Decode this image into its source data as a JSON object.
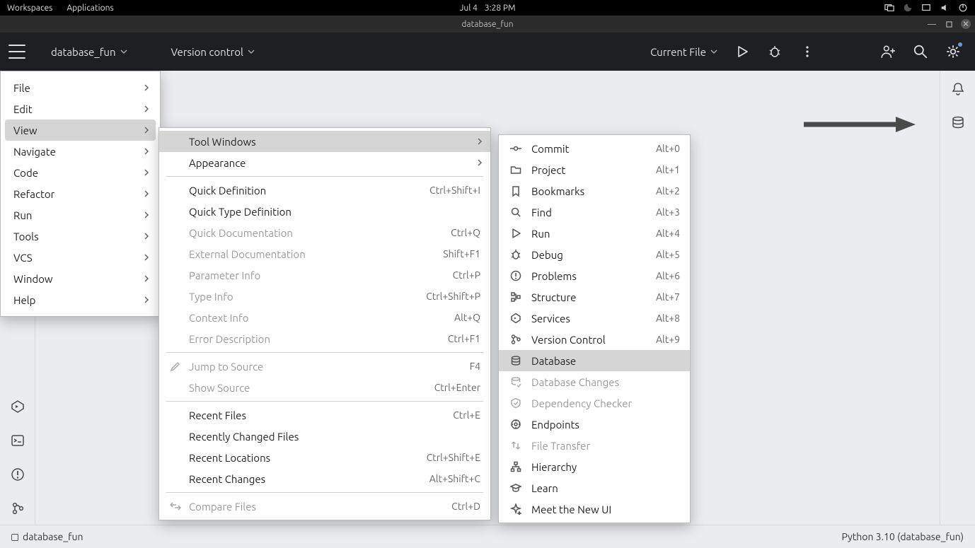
{
  "system_bar": {
    "workspaces": "Workspaces",
    "applications": "Applications",
    "date": "Jul 4",
    "time": "3:28 PM"
  },
  "window_title": "database_fun",
  "toolbar": {
    "project": "database_fun",
    "vcs": "Version control",
    "run_config": "Current File"
  },
  "main_menu": [
    {
      "label": "File"
    },
    {
      "label": "Edit"
    },
    {
      "label": "View",
      "highlighted": true
    },
    {
      "label": "Navigate"
    },
    {
      "label": "Code"
    },
    {
      "label": "Refactor"
    },
    {
      "label": "Run"
    },
    {
      "label": "Tools"
    },
    {
      "label": "VCS"
    },
    {
      "label": "Window"
    },
    {
      "label": "Help"
    }
  ],
  "view_menu": [
    {
      "label": "Tool Windows",
      "submenu": true,
      "highlighted": true
    },
    {
      "label": "Appearance",
      "submenu": true
    },
    {
      "sep": true
    },
    {
      "label": "Quick Definition",
      "shortcut": "Ctrl+Shift+I"
    },
    {
      "label": "Quick Type Definition"
    },
    {
      "label": "Quick Documentation",
      "shortcut": "Ctrl+Q",
      "disabled": true
    },
    {
      "label": "External Documentation",
      "shortcut": "Shift+F1",
      "disabled": true
    },
    {
      "label": "Parameter Info",
      "shortcut": "Ctrl+P",
      "disabled": true
    },
    {
      "label": "Type Info",
      "shortcut": "Ctrl+Shift+P",
      "disabled": true
    },
    {
      "label": "Context Info",
      "shortcut": "Alt+Q",
      "disabled": true
    },
    {
      "label": "Error Description",
      "shortcut": "Ctrl+F1",
      "disabled": true
    },
    {
      "sep": true
    },
    {
      "label": "Jump to Source",
      "shortcut": "F4",
      "icon": "pencil",
      "disabled": true
    },
    {
      "label": "Show Source",
      "shortcut": "Ctrl+Enter",
      "disabled": true
    },
    {
      "sep": true
    },
    {
      "label": "Recent Files",
      "shortcut": "Ctrl+E"
    },
    {
      "label": "Recently Changed Files"
    },
    {
      "label": "Recent Locations",
      "shortcut": "Ctrl+Shift+E"
    },
    {
      "label": "Recent Changes",
      "shortcut": "Alt+Shift+C"
    },
    {
      "sep": true
    },
    {
      "label": "Compare Files",
      "shortcut": "Ctrl+D",
      "icon": "compare",
      "disabled": true
    }
  ],
  "toolwin_menu": [
    {
      "label": "Commit",
      "shortcut": "Alt+0",
      "icon": "commit"
    },
    {
      "label": "Project",
      "shortcut": "Alt+1",
      "icon": "folder"
    },
    {
      "label": "Bookmarks",
      "shortcut": "Alt+2",
      "icon": "bookmark"
    },
    {
      "label": "Find",
      "shortcut": "Alt+3",
      "icon": "search"
    },
    {
      "label": "Run",
      "shortcut": "Alt+4",
      "icon": "play"
    },
    {
      "label": "Debug",
      "shortcut": "Alt+5",
      "icon": "bug"
    },
    {
      "label": "Problems",
      "shortcut": "Alt+6",
      "icon": "warn"
    },
    {
      "label": "Structure",
      "shortcut": "Alt+7",
      "icon": "structure"
    },
    {
      "label": "Services",
      "shortcut": "Alt+8",
      "icon": "services"
    },
    {
      "label": "Version Control",
      "shortcut": "Alt+9",
      "icon": "branch"
    },
    {
      "label": "Database",
      "icon": "database",
      "highlighted": true
    },
    {
      "label": "Database Changes",
      "icon": "dbchanges",
      "disabled": true
    },
    {
      "label": "Dependency Checker",
      "icon": "depcheck",
      "disabled": true
    },
    {
      "label": "Endpoints",
      "icon": "endpoints"
    },
    {
      "label": "File Transfer",
      "icon": "transfer",
      "disabled": true
    },
    {
      "label": "Hierarchy",
      "icon": "hierarchy"
    },
    {
      "label": "Learn",
      "icon": "learn"
    },
    {
      "label": "Meet the New UI",
      "icon": "sparkle"
    }
  ],
  "status_bar": {
    "left": "database_fun",
    "right": "Python 3.10 (database_fun)"
  }
}
